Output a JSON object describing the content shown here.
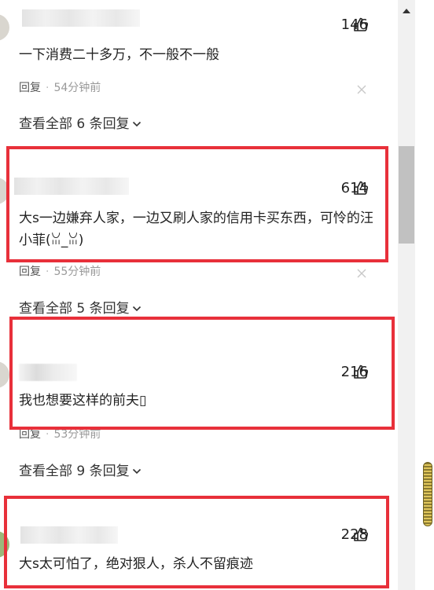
{
  "comments": [
    {
      "likes": "146",
      "text": "一下消费二十多万，不一般不一般",
      "reply_label": "回复",
      "time": "54分钟前",
      "view_replies": "查看全部 6 条回复"
    },
    {
      "likes": "614",
      "text": "大s一边嫌弃人家，一边又刷人家的信用卡买东西，可怜的汪小菲(ꈍ_ꈍ)",
      "reply_label": "回复",
      "time": "55分钟前",
      "view_replies": "查看全部 5 条回复"
    },
    {
      "likes": "216",
      "text": "我也想要这样的前夫▯",
      "reply_label": "回复",
      "time": "53分钟前",
      "view_replies": "查看全部 9 条回复"
    },
    {
      "likes": "228",
      "text": "大s太可怕了，绝对狠人，杀人不留痕迹"
    }
  ],
  "colors": {
    "highlight_border": "#e8303a",
    "meta_text": "#999999",
    "scroll_thumb": "#c1c1c1"
  },
  "icons": {
    "like": "thumbs-up-icon",
    "close": "close-icon",
    "expand": "chevron-down-icon",
    "scroll_up": "scroll-up-arrow-icon"
  }
}
